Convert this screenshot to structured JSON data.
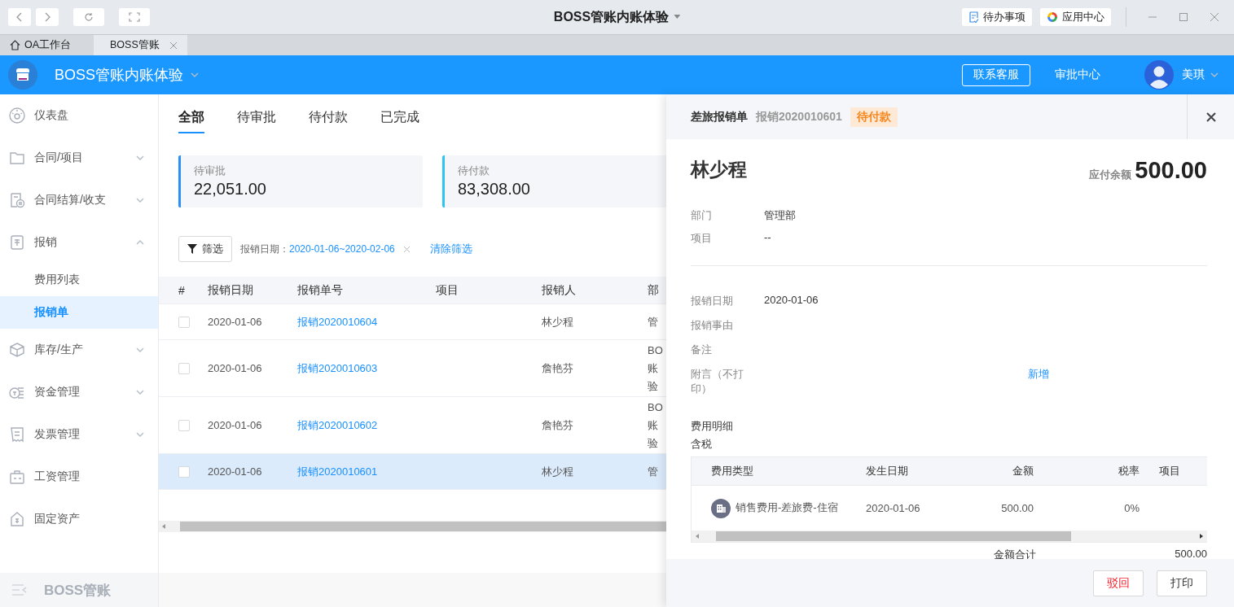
{
  "titlebar": {
    "title": "BOSS管账内账体验",
    "buttons": [
      {
        "label": "待办事项",
        "kind": "todo"
      },
      {
        "label": "应用中心",
        "kind": "apps"
      }
    ]
  },
  "browser_tabs": [
    {
      "label": "OA工作台",
      "selected": false,
      "kind": "home"
    },
    {
      "label": "BOSS管账",
      "selected": true,
      "kind": "closable"
    }
  ],
  "header": {
    "company": "BOSS管账内账体验",
    "contact_button": "联系客服",
    "approval_link": "审批中心",
    "user": "美琪"
  },
  "sidebar": {
    "items": [
      {
        "label": "仪表盘"
      },
      {
        "label": "合同/项目",
        "expanded": false
      },
      {
        "label": "合同结算/收支",
        "expanded": false
      },
      {
        "label": "报销",
        "expanded": true,
        "children": [
          {
            "label": "费用列表",
            "selected": false
          },
          {
            "label": "报销单",
            "selected": true
          }
        ]
      },
      {
        "label": "库存/生产",
        "expanded": false
      },
      {
        "label": "资金管理",
        "expanded": false
      },
      {
        "label": "发票管理",
        "expanded": false
      },
      {
        "label": "工资管理"
      },
      {
        "label": "固定资产"
      }
    ],
    "footer": "BOSS管账"
  },
  "main": {
    "tabs": [
      {
        "label": "全部",
        "selected": true
      },
      {
        "label": "待审批",
        "selected": false
      },
      {
        "label": "待付款",
        "selected": false
      },
      {
        "label": "已完成",
        "selected": false
      }
    ],
    "stats": [
      {
        "label": "待审批",
        "value": "22,051.00",
        "color": "#2a8ff7"
      },
      {
        "label": "待付款",
        "value": "83,308.00",
        "color": "#2ec4f2"
      }
    ],
    "filter": {
      "button": "筛选",
      "label": "报销日期：",
      "value": "2020-01-06~2020-02-06",
      "clear": "清除筛选"
    },
    "table": {
      "columns": [
        "#",
        "报销日期",
        "报销单号",
        "项目",
        "报销人",
        "部"
      ],
      "rows": [
        {
          "checked": false,
          "selected": false,
          "date": "2020-01-06",
          "number": "报销2020010604",
          "person": "林少程",
          "department": [
            "管"
          ]
        },
        {
          "checked": false,
          "selected": false,
          "date": "2020-01-06",
          "number": "报销2020010603",
          "person": "詹艳芬",
          "department": [
            "BO",
            "账",
            "验"
          ]
        },
        {
          "checked": false,
          "selected": false,
          "date": "2020-01-06",
          "number": "报销2020010602",
          "person": "詹艳芬",
          "department": [
            "BO",
            "账",
            "验"
          ]
        },
        {
          "checked": false,
          "selected": true,
          "date": "2020-01-06",
          "number": "报销2020010601",
          "person": "林少程",
          "department": [
            "管"
          ]
        }
      ]
    }
  },
  "drawer": {
    "type_label": "差旅报销单",
    "number": "报销2020010601",
    "status": "待付款",
    "name": "林少程",
    "balance_label": "应付余额",
    "balance": "500.00",
    "fields1": [
      {
        "label": "部门",
        "value": "管理部"
      },
      {
        "label": "项目",
        "value": "--"
      }
    ],
    "fields2": [
      {
        "label": "报销日期",
        "value": "2020-01-06"
      },
      {
        "label": "报销事由"
      },
      {
        "label": "备注"
      },
      {
        "label": "附言（不打印）",
        "action": "新增"
      }
    ],
    "details_title": "费用明细",
    "tax_note": "含税",
    "detail_table": {
      "columns": [
        "费用类型",
        "发生日期",
        "金额",
        "税率",
        "项目"
      ],
      "rows": [
        {
          "type": "销售费用-差旅费-住宿",
          "date": "2020-01-06",
          "amount": "500.00",
          "rate": "0%"
        }
      ]
    },
    "total_label": "金额合计",
    "total": "500.00",
    "buttons": [
      {
        "label": "驳回",
        "kind": "danger"
      },
      {
        "label": "打印",
        "kind": "default"
      }
    ]
  }
}
